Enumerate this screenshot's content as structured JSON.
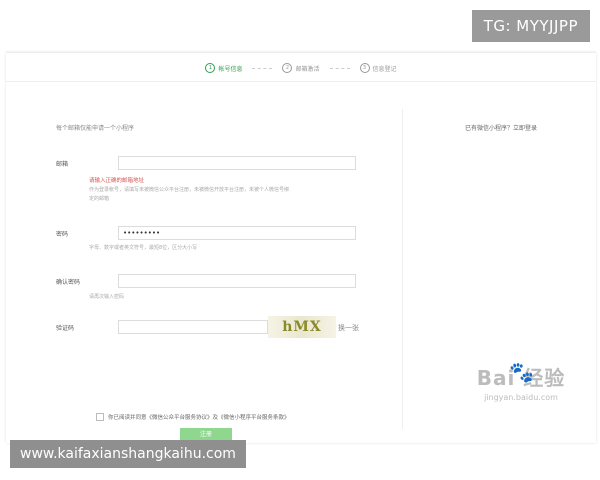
{
  "tg_badge": "TG: MYYJJPP",
  "site_badge": "www.kaifaxianshangkaihu.com",
  "steps": [
    {
      "num": "1",
      "label": "帐号信息"
    },
    {
      "num": "2",
      "label": "邮箱激活"
    },
    {
      "num": "3",
      "label": "信息登记"
    }
  ],
  "form": {
    "intro": "每个邮箱仅能申请一个小程序",
    "email": {
      "label": "邮箱",
      "value": "",
      "error": "请输入正确的邮箱地址",
      "hint_line1": "作为登录帐号，请填写未被微信公众平台注册，未被微信开放平台注册，未被个人微信号绑",
      "hint_line2": "定的邮箱"
    },
    "password": {
      "label": "密码",
      "value": "•••••••••",
      "hint": "字母、数字或者英文符号，最短8位，区分大小写"
    },
    "confirm": {
      "label": "确认密码",
      "value": "",
      "hint": "请再次输入密码"
    },
    "captcha": {
      "label": "验证码",
      "value": "",
      "image_text": "hMX",
      "refresh": "换一张"
    },
    "agree": {
      "text": "你已阅读并同意《微信公众平台服务协议》及《微信小程序平台服务条款》"
    },
    "submit": "注册"
  },
  "right_panel": {
    "text": "已有微信小程序？立即登录"
  },
  "watermark": {
    "brand": "Bai 经验",
    "url": "jingyan.baidu.com"
  }
}
